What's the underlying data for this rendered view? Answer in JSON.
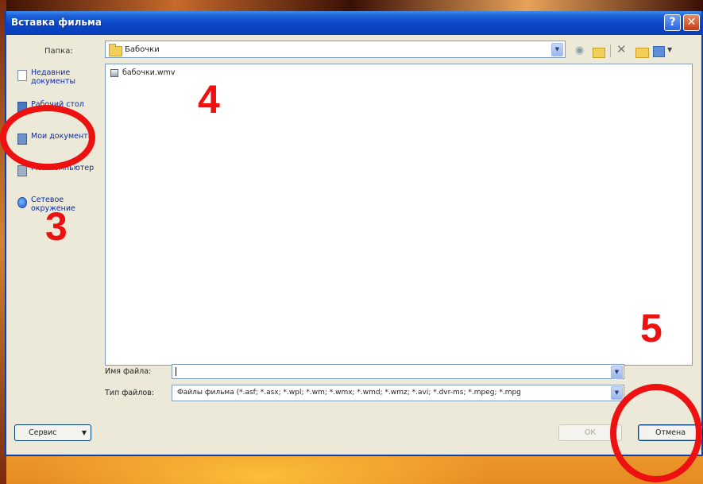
{
  "window": {
    "title": "Вставка фильма",
    "help_glyph": "?",
    "close_glyph": "✕"
  },
  "look_in": {
    "label": "Папка:",
    "value": "Бабочки"
  },
  "places": [
    {
      "label": "Недавние документы",
      "icon": "recent-documents-icon"
    },
    {
      "label": "Рабочий стол",
      "icon": "desktop-icon"
    },
    {
      "label": "Мои документы",
      "icon": "my-documents-icon"
    },
    {
      "label": "Мой компьютер",
      "icon": "my-computer-icon"
    },
    {
      "label": "Сетевое окружение",
      "icon": "network-icon"
    }
  ],
  "files": [
    {
      "name": "бабочки.wmv",
      "icon": "video-file-icon"
    }
  ],
  "file_name": {
    "label": "Имя файла:",
    "value": ""
  },
  "file_type": {
    "label": "Тип файлов:",
    "value": "Файлы фильма (*.asf; *.asx; *.wpl; *.wm; *.wmx; *.wmd; *.wmz; *.avi; *.dvr-ms; *.mpeg; *.mpg"
  },
  "buttons": {
    "tools": "Сервис",
    "ok": "ОК",
    "cancel": "Отмена"
  },
  "annotations": {
    "step_3": "3",
    "step_4": "4",
    "step_5": "5",
    "color": "#ee1111"
  }
}
